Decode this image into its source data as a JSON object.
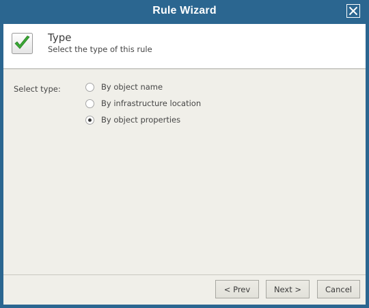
{
  "window": {
    "title": "Rule Wizard"
  },
  "header": {
    "icon": "check-icon",
    "title": "Type",
    "subtitle": "Select the type of this rule"
  },
  "form": {
    "select_label": "Select type:",
    "options": [
      {
        "label": "By object name",
        "checked": false
      },
      {
        "label": "By infrastructure location",
        "checked": false
      },
      {
        "label": "By object properties",
        "checked": true
      }
    ]
  },
  "buttons": {
    "prev": "< Prev",
    "next": "Next >",
    "cancel": "Cancel"
  },
  "colors": {
    "titlebar": "#2b6690",
    "content_bg": "#f0efe9",
    "check_green": "#3aa935"
  }
}
